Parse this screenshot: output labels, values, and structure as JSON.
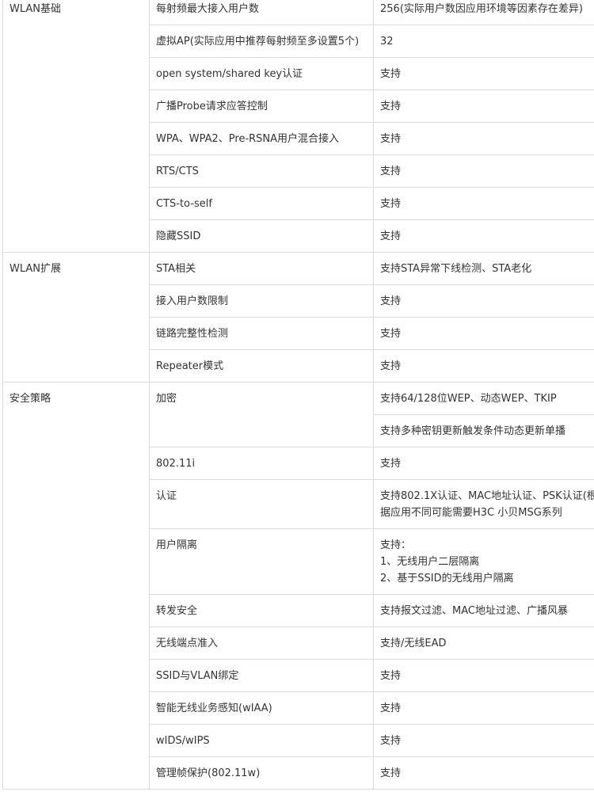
{
  "sections": [
    {
      "category": "WLAN基础",
      "rows": [
        {
          "feature": "每射频最大接入用户数",
          "values": [
            "256(实际用户数因应用环境等因素存在差异)"
          ]
        },
        {
          "feature": "虚拟AP(实际应用中推荐每射频至多设置5个)",
          "values": [
            "32"
          ]
        },
        {
          "feature": "open system/shared key认证",
          "values": [
            "支持"
          ]
        },
        {
          "feature": "广播Probe请求应答控制",
          "values": [
            "支持"
          ]
        },
        {
          "feature": "WPA、WPA2、Pre-RSNA用户混合接入",
          "values": [
            "支持"
          ]
        },
        {
          "feature": "RTS/CTS",
          "values": [
            "支持"
          ]
        },
        {
          "feature": "CTS-to-self",
          "values": [
            "支持"
          ]
        },
        {
          "feature": "隐藏SSID",
          "values": [
            "支持"
          ]
        }
      ]
    },
    {
      "category": "WLAN扩展",
      "rows": [
        {
          "feature": "STA相关",
          "values": [
            "支持STA异常下线检测、STA老化"
          ]
        },
        {
          "feature": "接入用户数限制",
          "values": [
            "支持"
          ]
        },
        {
          "feature": "链路完整性检测",
          "values": [
            "支持"
          ]
        },
        {
          "feature": "Repeater模式",
          "values": [
            "支持"
          ]
        }
      ]
    },
    {
      "category": "安全策略",
      "rows": [
        {
          "feature": "加密",
          "values": [
            "支持64/128位WEP、动态WEP、TKIP",
            "支持多种密钥更新触发条件动态更新单播"
          ]
        },
        {
          "feature": "802.11i",
          "values": [
            "支持"
          ]
        },
        {
          "feature": "认证",
          "values": [
            "支持802.1X认证、MAC地址认证、PSK认证(根据应用不同可能需要H3C 小贝MSG系列"
          ]
        },
        {
          "feature": "用户隔离",
          "values": [
            "支持：\n1、无线用户二层隔离\n2、基于SSID的无线用户隔离"
          ]
        },
        {
          "feature": "转发安全",
          "values": [
            "支持报文过滤、MAC地址过滤、广播风暴"
          ]
        },
        {
          "feature": "无线端点准入",
          "values": [
            "支持/无线EAD"
          ]
        },
        {
          "feature": "SSID与VLAN绑定",
          "values": [
            "支持"
          ]
        },
        {
          "feature": "智能无线业务感知(wIAA)",
          "values": [
            "支持"
          ]
        },
        {
          "feature": "wIDS/wIPS",
          "values": [
            "支持"
          ]
        },
        {
          "feature": "管理帧保护(802.11w)",
          "values": [
            "支持"
          ]
        }
      ]
    }
  ]
}
